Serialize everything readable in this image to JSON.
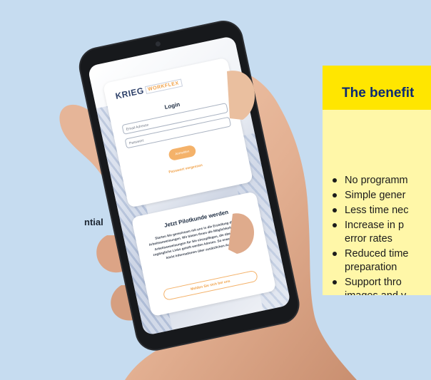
{
  "side_text": {
    "line1": "",
    "line2": "ntial"
  },
  "benefits": {
    "heading": "The benefit",
    "items": [
      [
        "No programm"
      ],
      [
        "Simple gener"
      ],
      [
        "Less time nec"
      ],
      [
        "Increase in p",
        "error rates"
      ],
      [
        "Reduced time",
        "preparation"
      ],
      [
        "Support thro",
        "images and v"
      ]
    ]
  },
  "phone_app": {
    "logo_main": "KRIEG",
    "logo_sub": "WORKFLEX",
    "login": {
      "title": "Login",
      "email_placeholder": "Email Adresse",
      "password_placeholder": "Passwort",
      "login_button": "Anmelden",
      "forgot_link": "Passwort vergessen"
    },
    "pilot": {
      "title": "Jetzt Pilotkunde werden",
      "body": "Starten Sie gemeinsam mit uns in die Erstellung digitaler Arbeitsanweisungen. Wir bieten Ihnen die Möglichkeit vorhandene Arbeitsanweisungen für Sie einzupflegen, die über öffentlich zugängliche Links geteilt werden können. So erweitern Sie ganz leicht Informationen über zusätzlichen Aufwand.",
      "cta_button": "Melden Sie sich bei uns"
    }
  },
  "colors": {
    "background": "#c6dcf0",
    "benefits_header": "#ffe600",
    "benefits_body": "#fff7a8",
    "heading_text": "#0b2a73",
    "accent_orange": "#f4b26a"
  }
}
